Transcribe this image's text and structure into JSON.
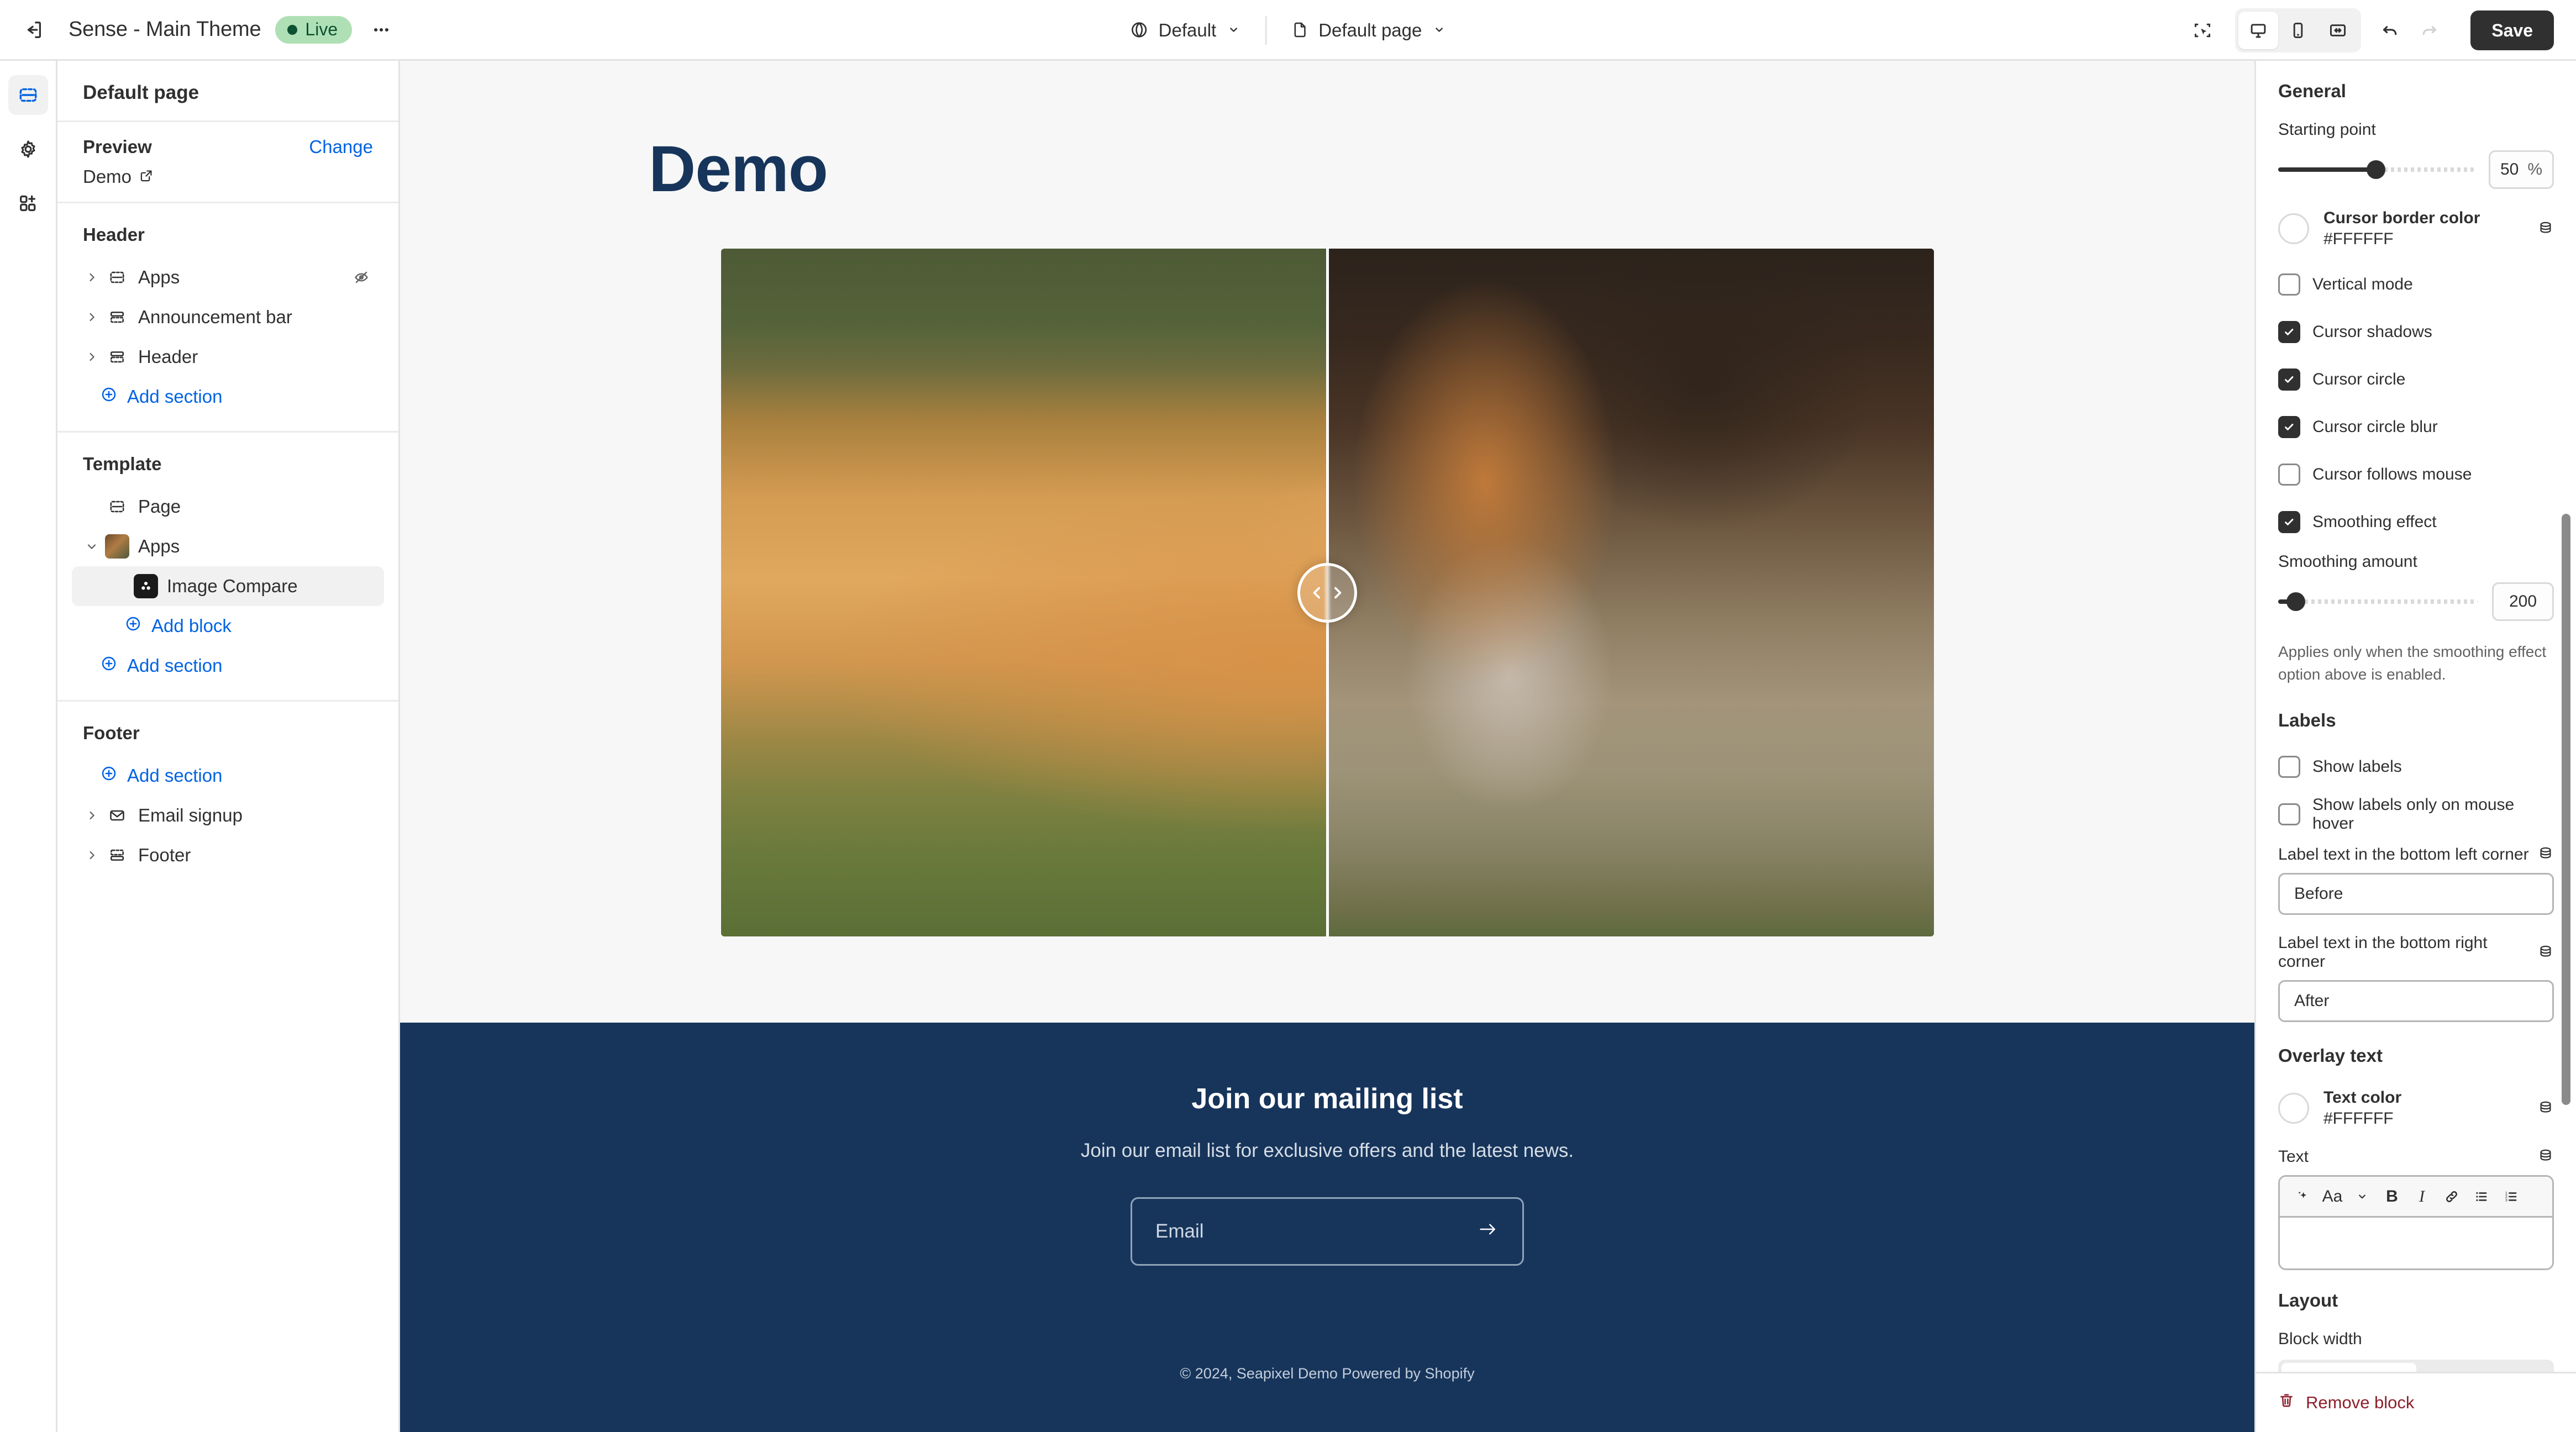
{
  "topbar": {
    "exit_icon": "exit-icon",
    "theme_name": "Sense - Main Theme",
    "live_label": "Live",
    "more_icon": "ellipsis-icon",
    "market_selector": {
      "icon": "globe-icon",
      "label": "Default",
      "chevron": "chevron-down-icon"
    },
    "page_selector": {
      "icon": "page-icon",
      "label": "Default page",
      "chevron": "chevron-down-icon"
    },
    "inspect_icon": "inspector-icon",
    "devices": [
      {
        "name": "desktop-icon",
        "active": true
      },
      {
        "name": "mobile-icon",
        "active": false
      },
      {
        "name": "fullwidth-icon",
        "active": false
      }
    ],
    "undo_icon": "undo-icon",
    "redo_icon": "redo-icon",
    "save_label": "Save"
  },
  "rail": {
    "items": [
      {
        "name": "sections-icon",
        "active": true
      },
      {
        "name": "gear-icon",
        "active": false
      },
      {
        "name": "apps-add-icon",
        "active": false
      }
    ]
  },
  "sidebar": {
    "title": "Default page",
    "preview": {
      "label": "Preview",
      "change_label": "Change",
      "value": "Demo",
      "external_icon": "external-link-icon"
    },
    "groups": [
      {
        "heading": "Header",
        "items": [
          {
            "label": "Apps",
            "icon": "section-icon",
            "caret": "chevron-right-icon",
            "trailing": "hidden-eye-icon"
          },
          {
            "label": "Announcement bar",
            "icon": "section-icon",
            "caret": "chevron-right-icon",
            "trailing": ""
          },
          {
            "label": "Header",
            "icon": "section-icon",
            "caret": "chevron-right-icon",
            "trailing": ""
          }
        ],
        "add_label": "Add section"
      },
      {
        "heading": "Template",
        "items": [
          {
            "label": "Page",
            "icon": "section-icon",
            "caret": "",
            "trailing": ""
          },
          {
            "label": "Apps",
            "icon": "app-thumb-icon",
            "caret": "chevron-down-icon",
            "trailing": ""
          }
        ],
        "block": {
          "label": "Image Compare",
          "icon": "image-compare-app-icon",
          "selected": true
        },
        "add_block_label": "Add block",
        "add_label": "Add section"
      },
      {
        "heading": "Footer",
        "add_label": "Add section",
        "items": [
          {
            "label": "Email signup",
            "icon": "envelope-icon",
            "caret": "chevron-right-icon",
            "trailing": ""
          },
          {
            "label": "Footer",
            "icon": "footer-icon",
            "caret": "chevron-right-icon",
            "trailing": ""
          }
        ]
      }
    ]
  },
  "preview": {
    "page_title": "Demo",
    "compare": {
      "divider_position_percent": 50,
      "handle_icon": "left-right-chevrons-icon",
      "before_alt": "fox lying in grass",
      "after_alt": "fox standing behind grass blurred"
    },
    "newsletter": {
      "title": "Join our mailing list",
      "subtitle": "Join our email list for exclusive offers and the latest news.",
      "email_placeholder": "Email",
      "submit_icon": "arrow-right-icon"
    },
    "copyright": "© 2024, Seapixel Demo Powered by Shopify"
  },
  "settings": {
    "general": {
      "heading": "General",
      "starting_point": {
        "label": "Starting point",
        "value": "50",
        "unit": "%",
        "percent": 50
      },
      "cursor_border_color": {
        "name": "Cursor border color",
        "hex": "#FFFFFF",
        "source_icon": "database-icon"
      },
      "checkboxes": [
        {
          "label": "Vertical mode",
          "checked": false
        },
        {
          "label": "Cursor shadows",
          "checked": true
        },
        {
          "label": "Cursor circle",
          "checked": true
        },
        {
          "label": "Cursor circle blur",
          "checked": true
        },
        {
          "label": "Cursor follows mouse",
          "checked": false
        },
        {
          "label": "Smoothing effect",
          "checked": true
        }
      ],
      "smoothing_amount": {
        "label": "Smoothing amount",
        "value": "200",
        "percent": 9,
        "help": "Applies only when the smoothing effect option above is enabled."
      }
    },
    "labels": {
      "heading": "Labels",
      "checkboxes": [
        {
          "label": "Show labels",
          "checked": false
        },
        {
          "label": "Show labels only on mouse hover",
          "checked": false
        }
      ],
      "left_label": {
        "label": "Label text in the bottom left corner",
        "value": "Before",
        "source_icon": "database-icon"
      },
      "right_label": {
        "label": "Label text in the bottom right corner",
        "value": "After",
        "source_icon": "database-icon"
      }
    },
    "overlay": {
      "heading": "Overlay text",
      "text_color": {
        "name": "Text color",
        "hex": "#FFFFFF",
        "source_icon": "database-icon"
      },
      "text_field": {
        "label": "Text",
        "source_icon": "database-icon",
        "value": "",
        "toolbar": [
          {
            "name": "ai-sparkle-icon",
            "label": ""
          },
          {
            "name": "font-size-icon",
            "label": "Aa"
          },
          {
            "name": "chevron-down-icon",
            "label": ""
          },
          {
            "name": "bold-icon",
            "label": "B"
          },
          {
            "name": "italic-icon",
            "label": "I"
          },
          {
            "name": "link-icon",
            "label": ""
          },
          {
            "name": "bulleted-list-icon",
            "label": ""
          },
          {
            "name": "numbered-list-icon",
            "label": ""
          }
        ]
      }
    },
    "layout": {
      "heading": "Layout",
      "block_width": {
        "label": "Block width"
      }
    },
    "remove_block_label": "Remove block"
  }
}
